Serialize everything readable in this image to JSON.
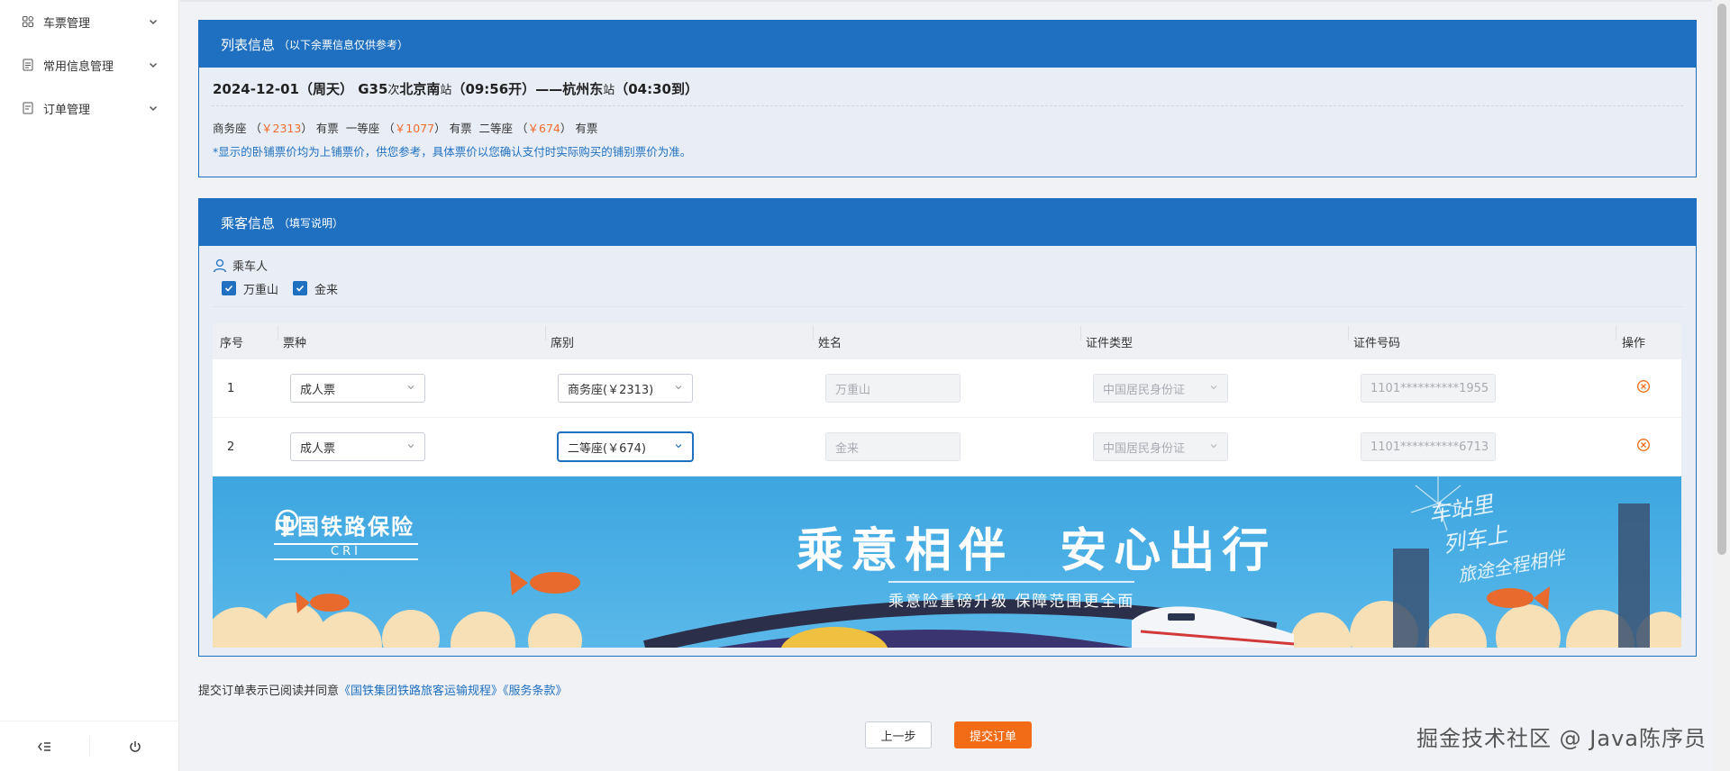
{
  "sidebar": {
    "items": [
      {
        "label": "车票管理",
        "icon": "grid-icon"
      },
      {
        "label": "常用信息管理",
        "icon": "document-icon"
      },
      {
        "label": "订单管理",
        "icon": "order-icon"
      }
    ],
    "bottom": {
      "collapse_icon": "collapse-icon",
      "power_icon": "power-icon"
    }
  },
  "trip_panel": {
    "title": "列表信息",
    "subtitle": "（以下余票信息仅供参考）",
    "date": "2024-12-01",
    "weekday": "（周天）",
    "train": "G35",
    "train_suffix": "次",
    "from_station": "北京南",
    "station_suffix": "站",
    "depart": "（09:56开）",
    "arrow": "——",
    "to_station": "杭州东",
    "arrive": "（04:30到）",
    "seats": [
      {
        "name": "商务座",
        "price": "￥2313",
        "availability": "有票"
      },
      {
        "name": "一等座",
        "price": "￥1077",
        "availability": "有票"
      },
      {
        "name": "二等座",
        "price": "￥674",
        "availability": "有票"
      }
    ],
    "note": "*显示的卧铺票价均为上铺票价，供您参考，具体票价以您确认支付时实际购买的铺别票价为准。"
  },
  "passenger_panel": {
    "title": "乘客信息",
    "subtitle": "（填写说明）",
    "passenger_label": "乘车人",
    "checkboxes": [
      {
        "label": "万重山",
        "checked": true
      },
      {
        "label": "金来",
        "checked": true
      }
    ],
    "columns": [
      "序号",
      "票种",
      "席别",
      "姓名",
      "证件类型",
      "证件号码",
      "操作"
    ],
    "rows": [
      {
        "index": "1",
        "ticket_type": "成人票",
        "seat": "商务座(￥2313)",
        "name": "万重山",
        "id_type": "中国居民身份证",
        "id_number": "1101**********1955"
      },
      {
        "index": "2",
        "ticket_type": "成人票",
        "seat": "二等座(￥674)",
        "name": "金来",
        "id_type": "中国居民身份证",
        "id_number": "1101**********6713"
      }
    ]
  },
  "banner": {
    "logo_text": "中国铁路保险",
    "logo_sub": "CRI",
    "slogan": "乘意相伴  安心出行",
    "subline": "乘意险重磅升级 保障范围更全面",
    "script_lines": [
      "车站里",
      "列车上",
      "旅途全程相伴"
    ]
  },
  "agreement": {
    "text": "提交订单表示已阅读并同意",
    "link1": "《国铁集团铁路旅客运输规程》",
    "link2": "《服务条款》"
  },
  "buttons": {
    "prev": "上一步",
    "submit": "提交订单"
  },
  "watermark": "掘金技术社区 @ Java陈序员",
  "colors": {
    "primary": "#1f70c1",
    "accent": "#f26c17",
    "price": "#f06c2f"
  }
}
